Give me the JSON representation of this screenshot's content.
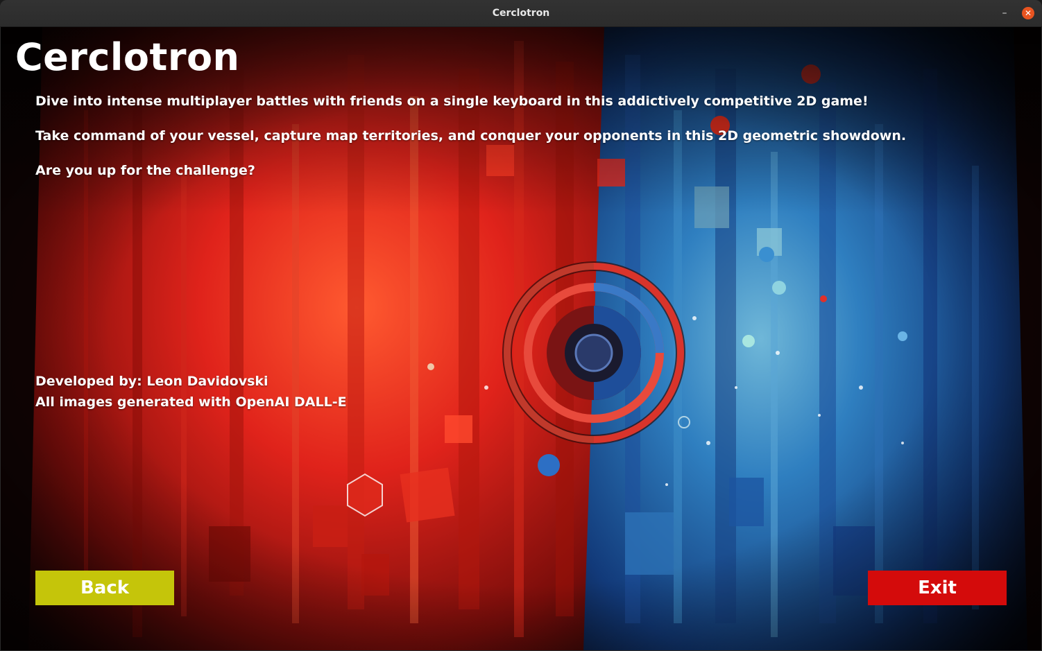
{
  "window": {
    "title": "Cerclotron",
    "minimize_glyph": "–",
    "close_glyph": "✕"
  },
  "main": {
    "heading": "Cerclotron",
    "paragraphs": [
      "Dive into intense multiplayer battles with friends on a single keyboard in this addictively competitive 2D game!",
      "Take command of your vessel, capture map territories, and conquer your opponents in this 2D geometric showdown.",
      "Are you up for the challenge?"
    ],
    "credits": {
      "developer": "Developed by: Leon Davidovski",
      "images": "All images generated with OpenAI DALL-E"
    }
  },
  "buttons": {
    "back_label": "Back",
    "exit_label": "Exit"
  },
  "colors": {
    "back_button": "#c5c50a",
    "exit_button": "#d40b0b",
    "close_button": "#e95420",
    "art_red": "#e0231b",
    "art_blue": "#1d5fb8"
  },
  "icons": {
    "minimize": "minimize-icon",
    "close": "close-icon"
  }
}
